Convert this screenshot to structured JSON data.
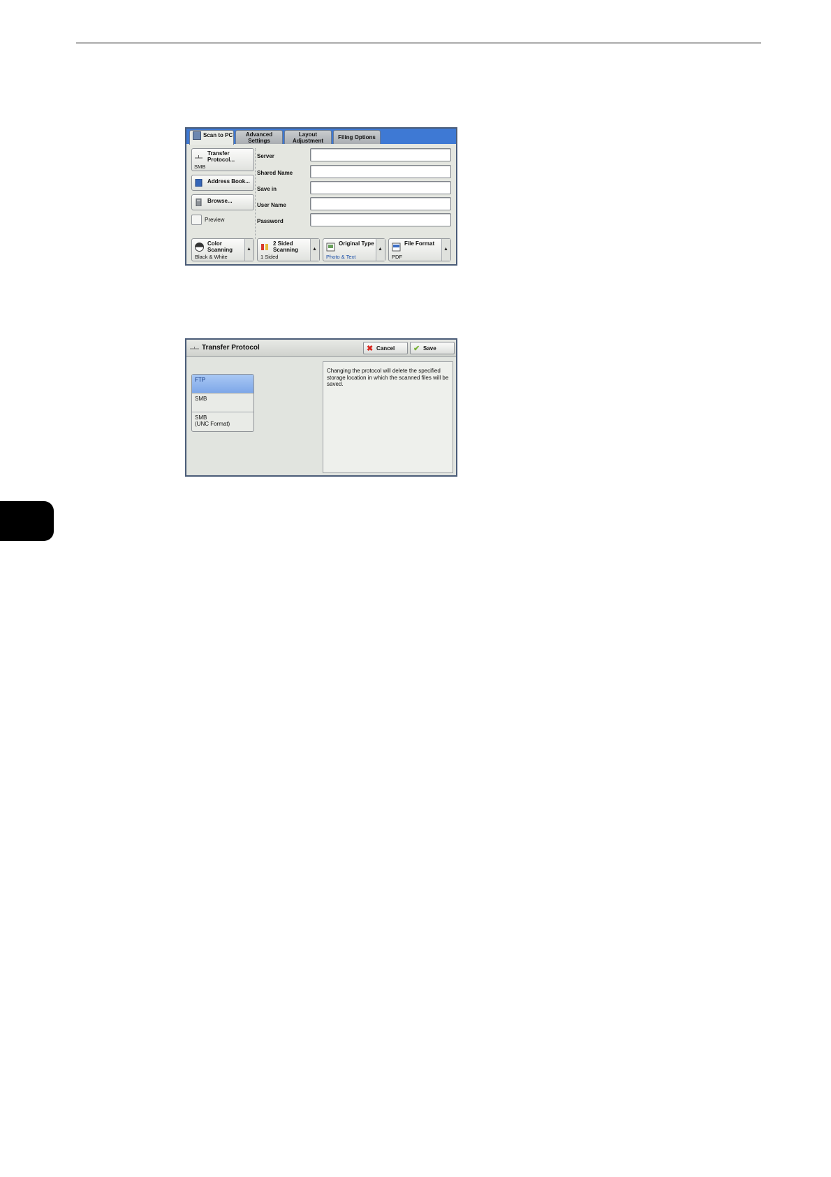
{
  "scan_screen": {
    "tabs": [
      {
        "label": "Scan to PC",
        "active": true
      },
      {
        "label": "Advanced Settings",
        "active": false
      },
      {
        "label": "Layout Adjustment",
        "active": false
      },
      {
        "label": "Filing Options",
        "active": false
      }
    ],
    "left_buttons": {
      "transfer_protocol": {
        "label": "Transfer Protocol...",
        "value": "SMB"
      },
      "address_book": {
        "label": "Address Book..."
      },
      "browse": {
        "label": "Browse..."
      },
      "preview": {
        "label": "Preview"
      }
    },
    "fields": [
      {
        "label": "Server",
        "value": ""
      },
      {
        "label": "Shared Name",
        "value": ""
      },
      {
        "label": "Save in",
        "value": ""
      },
      {
        "label": "User Name",
        "value": ""
      },
      {
        "label": "Password",
        "value": ""
      }
    ],
    "feature_buttons": [
      {
        "label": "Color Scanning",
        "value": "Black & White"
      },
      {
        "label": "2 Sided Scanning",
        "value": "1 Sided"
      },
      {
        "label": "Original Type",
        "value": "Photo & Text"
      },
      {
        "label": "File Format",
        "value": "PDF"
      }
    ],
    "accent_color": "#3e79d4"
  },
  "protocol_screen": {
    "title": "Transfer Protocol",
    "cancel_label": "Cancel",
    "save_label": "Save",
    "options": [
      {
        "label": "FTP",
        "selected": true
      },
      {
        "label": "SMB",
        "selected": false
      },
      {
        "label": "SMB\n(UNC Format)",
        "selected": false
      }
    ],
    "note": "Changing the protocol will delete the specified storage location in which the scanned files will be saved."
  }
}
